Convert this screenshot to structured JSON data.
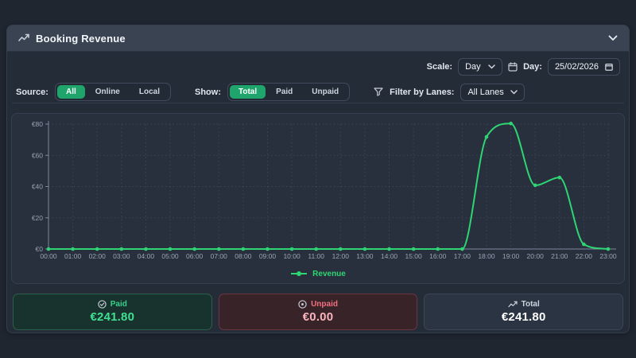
{
  "header": {
    "title": "Booking Revenue"
  },
  "controls": {
    "scale_label": "Scale:",
    "scale_value": "Day",
    "day_label": "Day:",
    "day_value": "25/02/2026"
  },
  "filters": {
    "source_label": "Source:",
    "source_options": [
      {
        "label": "All",
        "active": true
      },
      {
        "label": "Online",
        "active": false
      },
      {
        "label": "Local",
        "active": false
      }
    ],
    "show_label": "Show:",
    "show_options": [
      {
        "label": "Total",
        "active": true
      },
      {
        "label": "Paid",
        "active": false
      },
      {
        "label": "Unpaid",
        "active": false
      }
    ],
    "lanes_label": "Filter by Lanes:",
    "lanes_value": "All Lanes"
  },
  "chart_data": {
    "type": "line",
    "title": "",
    "x": [
      "00:00",
      "01:00",
      "02:00",
      "03:00",
      "04:00",
      "05:00",
      "06:00",
      "07:00",
      "08:00",
      "09:00",
      "10:00",
      "11:00",
      "12:00",
      "13:00",
      "14:00",
      "15:00",
      "16:00",
      "17:00",
      "18:00",
      "19:00",
      "20:00",
      "21:00",
      "22:00",
      "23:00"
    ],
    "series": [
      {
        "name": "Revenue",
        "color": "#2fd573",
        "values": [
          0,
          0,
          0,
          0,
          0,
          0,
          0,
          0,
          0,
          0,
          0,
          0,
          0,
          0,
          0,
          0,
          0,
          0,
          71.8,
          80.4,
          40.8,
          45.8,
          3,
          0
        ]
      }
    ],
    "xlabel": "",
    "ylabel": "",
    "ylim": [
      0,
      80
    ],
    "y_ticks": [
      0,
      20,
      40,
      60,
      80
    ],
    "y_tick_prefix": "€",
    "grid": true,
    "legend_position": "bottom",
    "colors": {
      "axis": "#7e879a",
      "grid": "#8e99ad",
      "tick_text": "#99a3b4"
    }
  },
  "summary": {
    "cards": [
      {
        "label": "Paid",
        "value": "€241.80",
        "icon": "check-circle-icon"
      },
      {
        "label": "Unpaid",
        "value": "€0.00",
        "icon": "dot-circle-icon"
      },
      {
        "label": "Total",
        "value": "€241.80",
        "icon": "trend-up-icon"
      }
    ]
  }
}
